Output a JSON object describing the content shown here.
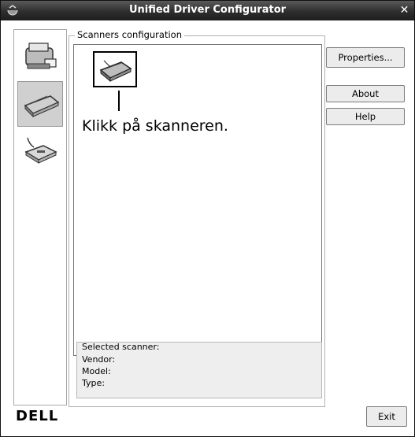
{
  "window": {
    "title": "Unified Driver Configurator"
  },
  "sidebar": {
    "items": [
      {
        "name": "printer-configuration",
        "icon": "printer-icon"
      },
      {
        "name": "scanner-configuration",
        "icon": "scanner-icon",
        "active": true
      },
      {
        "name": "port-configuration",
        "icon": "port-icon"
      }
    ]
  },
  "main": {
    "group_label": "Scanners configuration",
    "callout_text": "Klikk på skanneren.",
    "selected_scanner": {
      "title": "Selected scanner:",
      "vendor_label": "Vendor:",
      "model_label": "Model:",
      "type_label": "Type:"
    }
  },
  "buttons": {
    "properties": "Properties...",
    "about": "About",
    "help": "Help",
    "exit": "Exit"
  },
  "brand": {
    "logo_text": "DELL"
  }
}
